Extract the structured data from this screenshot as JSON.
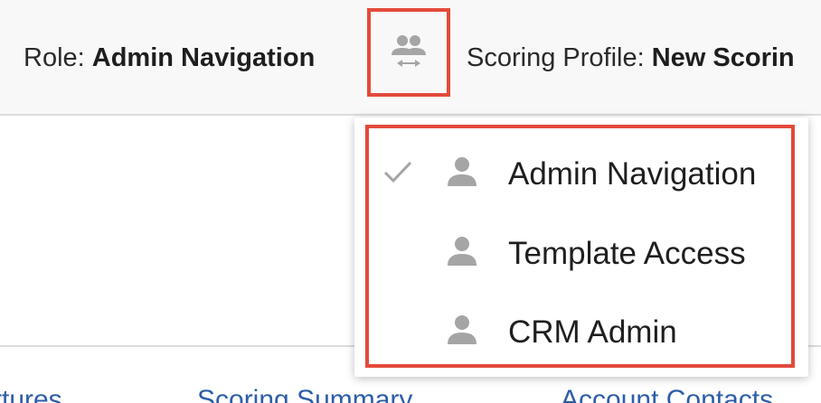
{
  "header": {
    "role_label": "Role:",
    "role_value": "Admin Navigation",
    "profile_label": "Scoring Profile:",
    "profile_value": "New Scorin"
  },
  "icons": {
    "switch": "switch-role-icon",
    "check": "check-icon",
    "person": "person-icon"
  },
  "role_menu": {
    "items": [
      {
        "label": "Admin Navigation",
        "selected": true
      },
      {
        "label": "Template Access",
        "selected": false
      },
      {
        "label": "CRM Admin",
        "selected": false
      }
    ]
  },
  "tabs": [
    "rtures",
    "Scoring Summary",
    "Account Contacts"
  ],
  "colors": {
    "highlight": "#e34a3b",
    "icon_gray": "#a5a5a5",
    "link_blue": "#2d5ea8"
  }
}
